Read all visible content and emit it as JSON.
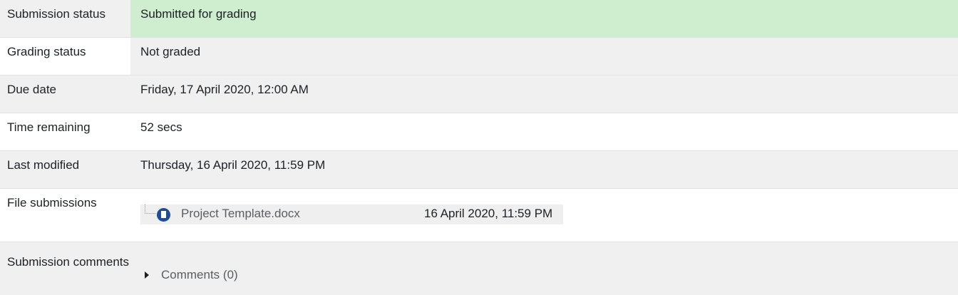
{
  "rows": [
    {
      "label": "Submission status",
      "value": "Submitted for grading"
    },
    {
      "label": "Grading status",
      "value": "Not graded"
    },
    {
      "label": "Due date",
      "value": "Friday, 17 April 2020, 12:00 AM"
    },
    {
      "label": "Time remaining",
      "value": "52 secs"
    },
    {
      "label": "Last modified",
      "value": "Thursday, 16 April 2020, 11:59 PM"
    },
    {
      "label": "File submissions"
    },
    {
      "label": "Submission comments"
    }
  ],
  "file": {
    "name": "Project Template.docx",
    "date": "16 April 2020, 11:59 PM",
    "icon": "document-icon"
  },
  "comments": {
    "label": "Comments (0)",
    "icon": "caret-right-icon"
  },
  "colors": {
    "success_bg": "#cfeecf",
    "row_alt_bg": "#f0f0f0",
    "file_icon": "#1f4b99"
  }
}
